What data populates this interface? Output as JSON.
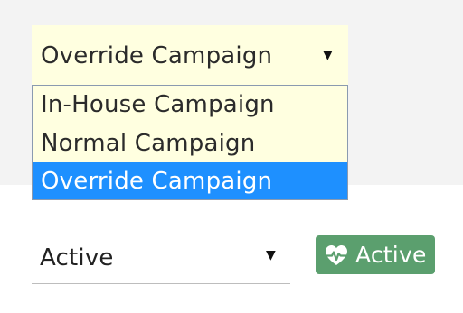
{
  "campaign_select": {
    "selected": "Override Campaign",
    "arrow_icon": "▼",
    "options": [
      {
        "label": "In-House Campaign",
        "selected": false
      },
      {
        "label": "Normal Campaign",
        "selected": false
      },
      {
        "label": "Override Campaign",
        "selected": true
      }
    ]
  },
  "status_select": {
    "selected": "Active",
    "arrow_icon": "▼"
  },
  "status_badge": {
    "icon": "heart-pulse-icon",
    "label": "Active",
    "color": "#5b9f6e"
  },
  "colors": {
    "select_background": "#ffffe0",
    "highlight": "#1e90ff",
    "panel_background": "#f3f3f3"
  }
}
